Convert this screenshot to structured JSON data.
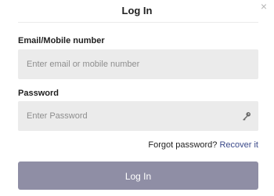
{
  "dialog": {
    "title": "Log In",
    "close_glyph": "×"
  },
  "email": {
    "label": "Email/Mobile number",
    "placeholder": "Enter email or mobile number",
    "value": ""
  },
  "password": {
    "label": "Password",
    "placeholder": "Enter Password",
    "value": "",
    "icon": "key-icon"
  },
  "forgot": {
    "text": "Forgot password?",
    "link_label": "Recover it"
  },
  "submit": {
    "label": "Log In"
  },
  "colors": {
    "button_bg": "#8f8ea5",
    "field_bg": "#ebebeb",
    "link": "#3b4a8a"
  }
}
